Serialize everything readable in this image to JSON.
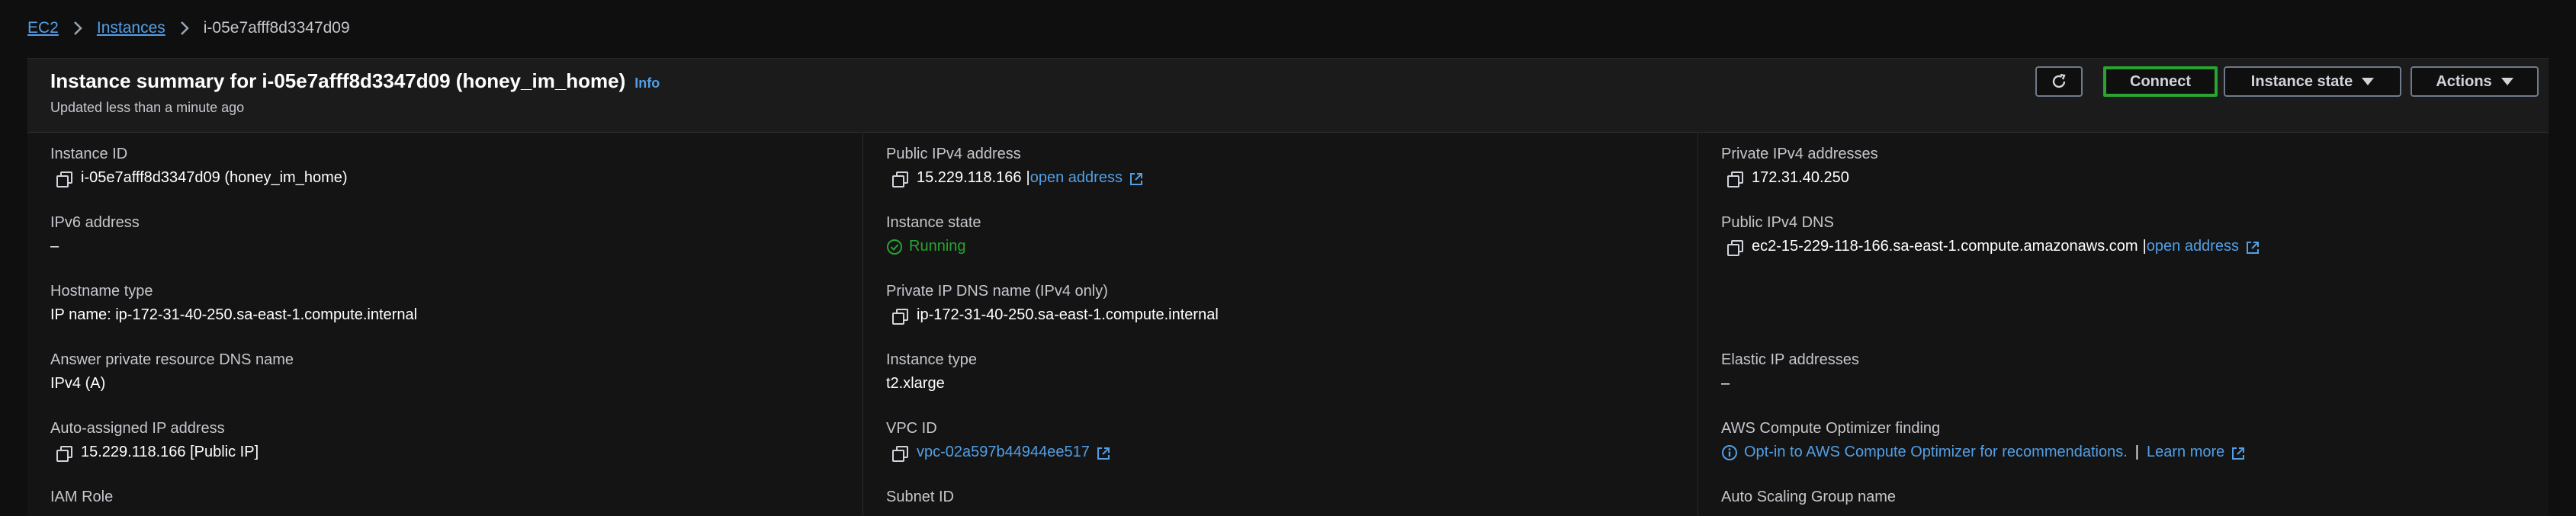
{
  "breadcrumb": {
    "ec2": "EC2",
    "instances": "Instances",
    "current": "i-05e7afff8d3347d09"
  },
  "header": {
    "title": "Instance summary for i-05e7afff8d3347d09 (honey_im_home)",
    "info": "Info",
    "subtitle": "Updated less than a minute ago",
    "connect": "Connect",
    "instance_state": "Instance state",
    "actions": "Actions"
  },
  "fields": {
    "instance_id": {
      "label": "Instance ID",
      "value": "i-05e7afff8d3347d09 (honey_im_home)"
    },
    "ipv6": {
      "label": "IPv6 address",
      "value": "–"
    },
    "hostname_type": {
      "label": "Hostname type",
      "value": "IP name: ip-172-31-40-250.sa-east-1.compute.internal"
    },
    "answer_dns": {
      "label": "Answer private resource DNS name",
      "value": "IPv4 (A)"
    },
    "auto_ip": {
      "label": "Auto-assigned IP address",
      "value": "15.229.118.166 [Public IP]"
    },
    "iam_role": {
      "label": "IAM Role"
    },
    "public_ipv4": {
      "label": "Public IPv4 address",
      "value": "15.229.118.166",
      "link": "open address"
    },
    "instance_state": {
      "label": "Instance state",
      "value": "Running"
    },
    "private_dns": {
      "label": "Private IP DNS name (IPv4 only)",
      "value": "ip-172-31-40-250.sa-east-1.compute.internal"
    },
    "instance_type": {
      "label": "Instance type",
      "value": "t2.xlarge"
    },
    "vpc_id": {
      "label": "VPC ID",
      "value": "vpc-02a597b44944ee517"
    },
    "subnet_id": {
      "label": "Subnet ID"
    },
    "private_ipv4": {
      "label": "Private IPv4 addresses",
      "value": "172.31.40.250"
    },
    "public_dns": {
      "label": "Public IPv4 DNS",
      "value": "ec2-15-229-118-166.sa-east-1.compute.amazonaws.com",
      "link": "open address"
    },
    "elastic_ip": {
      "label": "Elastic IP addresses",
      "value": "–"
    },
    "optimizer": {
      "label": "AWS Compute Optimizer finding",
      "value": "Opt-in to AWS Compute Optimizer for recommendations.",
      "separator": "|",
      "link": "Learn more"
    },
    "asg": {
      "label": "Auto Scaling Group name"
    }
  },
  "colors": {
    "link": "#539fe5",
    "running": "#29a331",
    "connect_border": "#29a331"
  },
  "icons": [
    "chevron-right-icon",
    "refresh-icon",
    "caret-down-icon",
    "copy-icon",
    "external-link-icon",
    "check-circle-icon",
    "info-circle-icon"
  ]
}
